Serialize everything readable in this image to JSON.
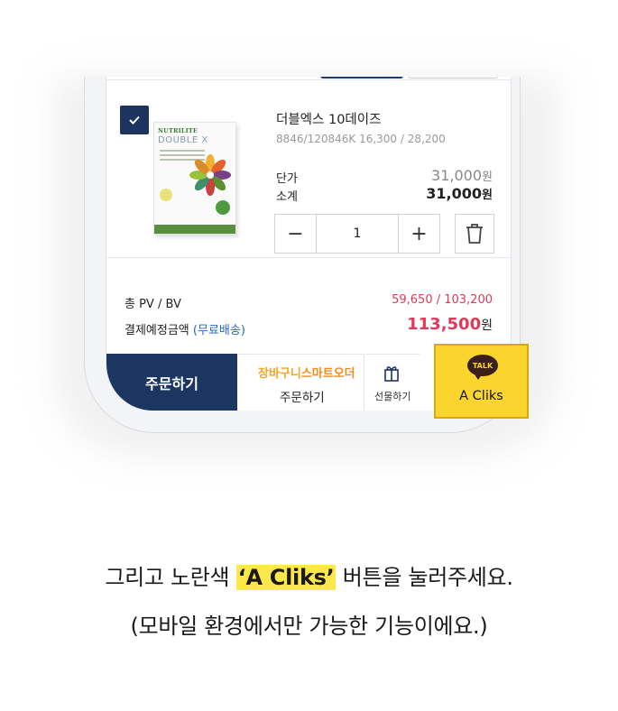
{
  "product": {
    "brand": "NUTRILITE",
    "name": "더블엑스 10데이즈",
    "code_line": "8846/120846K 16,300 / 28,200",
    "unit_price_label": "단가",
    "subtotal_label": "소계",
    "unit_price": "31,000",
    "subtotal": "31,000",
    "currency": "원",
    "quantity": "1",
    "minus": "−",
    "plus": "+"
  },
  "totals": {
    "pvbv_label": "총 PV / BV",
    "pvbv_value": "59,650 / 103,200",
    "payment_label": "결제예정금액",
    "shipping_note": "(무료배송)",
    "payment_amount": "113,500",
    "currency": "원"
  },
  "actions": {
    "order_label": "주문하기",
    "smart_title_a": "장바구니",
    "smart_title_b": "스마트오더",
    "smart_sub": "주문하기",
    "gift_label": "선물하기",
    "talk_badge": "TALK",
    "acliks_label": "A Cliks"
  },
  "caption": {
    "line1_pre": "그리고 노란색 ",
    "line1_highlight": "‘A Cliks’",
    "line1_post": " 버튼을 눌러주세요.",
    "line2": "(모바일 환경에서만 가능한 기능이에요.)"
  },
  "colors": {
    "navy": "#1b3761",
    "accent_red": "#e03a58",
    "kakao_yellow": "#fbd52e",
    "link_blue": "#2a65c8"
  }
}
